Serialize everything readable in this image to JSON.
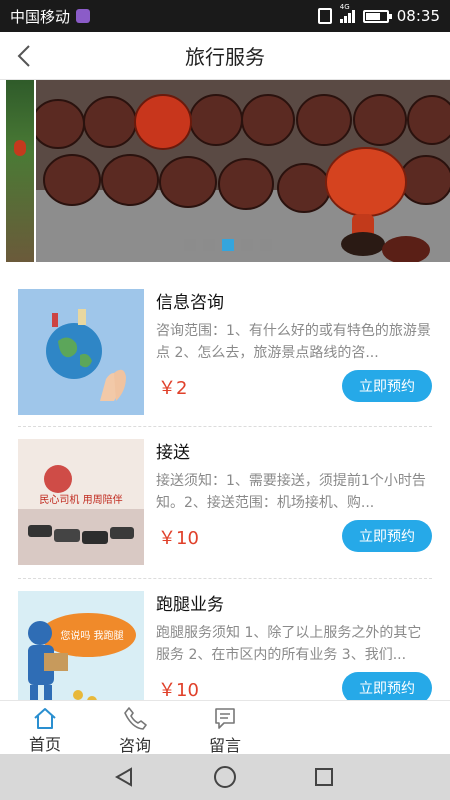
{
  "status_bar": {
    "carrier": "中国移动",
    "network": "4G",
    "time": "08:35",
    "battery_level": 0.7
  },
  "header": {
    "title": "旅行服务"
  },
  "banner": {
    "slide_count": 5,
    "active_index": 2,
    "colors": {
      "active_dot": "#2aa7e6",
      "dot": "#8c8c8c"
    }
  },
  "services": [
    {
      "title": "信息咨询",
      "description": "咨询范围：1、有什么好的或有特色的旅游景点 2、怎么去，旅游景点路线的咨...",
      "price": "￥2",
      "button": "立即预约"
    },
    {
      "title": "接送",
      "description": "接送须知：1、需要接送，须提前1个小时告知。2、接送范围：机场接机、购...",
      "price": "￥10",
      "button": "立即预约",
      "thumb_text": "民心司机 用周陪伴"
    },
    {
      "title": "跑腿业务",
      "description": "跑腿服务须知 1、除了以上服务之外的其它服务 2、在市区内的所有业务 3、我们...",
      "price": "￥10",
      "button": "立即预约",
      "thumb_text": "您说吗 我跑腿"
    }
  ],
  "tabs": [
    {
      "label": "首页",
      "icon": "home-icon",
      "active": true
    },
    {
      "label": "咨询",
      "icon": "phone-icon",
      "active": false
    },
    {
      "label": "留言",
      "icon": "message-icon",
      "active": false
    }
  ],
  "colors": {
    "accent": "#26a9e8",
    "price": "#e0402a"
  }
}
